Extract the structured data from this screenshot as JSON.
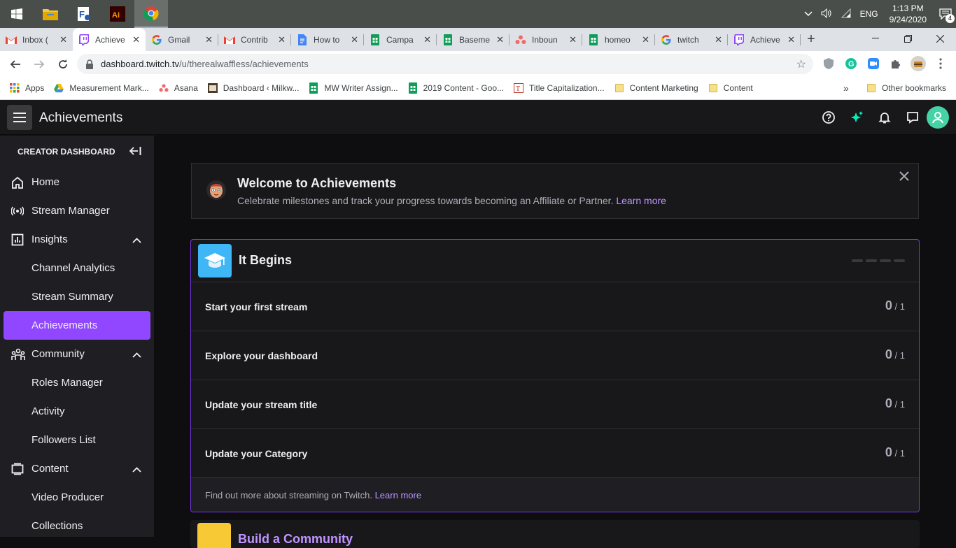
{
  "taskbar": {
    "apps": [
      "start",
      "file-explorer",
      "foxit-reader",
      "adobe-illustrator",
      "chrome"
    ],
    "time": "1:13 PM",
    "date": "9/24/2020",
    "language": "ENG",
    "notification_count": "4"
  },
  "browser": {
    "tabs": [
      {
        "label": "Inbox (",
        "icon": "gmail"
      },
      {
        "label": "Achieve",
        "icon": "twitch",
        "active": true
      },
      {
        "label": "Gmail",
        "icon": "google"
      },
      {
        "label": "Contrib",
        "icon": "gmail"
      },
      {
        "label": "How to",
        "icon": "docs"
      },
      {
        "label": "Campa",
        "icon": "sheets"
      },
      {
        "label": "Baseme",
        "icon": "sheets"
      },
      {
        "label": "Inboun",
        "icon": "asana"
      },
      {
        "label": "homeo",
        "icon": "sheets"
      },
      {
        "label": "twitch",
        "icon": "google"
      },
      {
        "label": "Achieve",
        "icon": "twitch"
      }
    ],
    "url_host": "dashboard.twitch.tv",
    "url_path": "/u/therealwaffless/achievements",
    "bookmarks": [
      {
        "label": "Apps",
        "icon": "apps-grid"
      },
      {
        "label": "Measurement Mark...",
        "icon": "drive"
      },
      {
        "label": "Asana",
        "icon": "asana"
      },
      {
        "label": "Dashboard ‹ Milkw...",
        "icon": "site"
      },
      {
        "label": "MW Writer Assign...",
        "icon": "sheets"
      },
      {
        "label": "2019 Content - Goo...",
        "icon": "sheets"
      },
      {
        "label": "Title Capitalization...",
        "icon": "tc"
      },
      {
        "label": "Content Marketing",
        "icon": "folder"
      },
      {
        "label": "Content",
        "icon": "folder"
      }
    ],
    "other_bookmarks": "Other bookmarks",
    "more": "»"
  },
  "twitch": {
    "page_title": "Achievements",
    "sidebar": {
      "heading": "CREATOR DASHBOARD",
      "items": [
        {
          "label": "Home",
          "icon": "home-icon",
          "type": "top"
        },
        {
          "label": "Stream Manager",
          "icon": "broadcast-icon",
          "type": "top"
        },
        {
          "label": "Insights",
          "icon": "insights-icon",
          "type": "top",
          "expanded": true
        },
        {
          "label": "Channel Analytics",
          "type": "sub"
        },
        {
          "label": "Stream Summary",
          "type": "sub"
        },
        {
          "label": "Achievements",
          "type": "sub",
          "active": true
        },
        {
          "label": "Community",
          "icon": "community-icon",
          "type": "top",
          "expanded": true
        },
        {
          "label": "Roles Manager",
          "type": "sub"
        },
        {
          "label": "Activity",
          "type": "sub"
        },
        {
          "label": "Followers List",
          "type": "sub"
        },
        {
          "label": "Content",
          "icon": "content-icon",
          "type": "top",
          "expanded": true
        },
        {
          "label": "Video Producer",
          "type": "sub"
        },
        {
          "label": "Collections",
          "type": "sub"
        }
      ]
    },
    "welcome": {
      "title": "Welcome to Achievements",
      "desc": "Celebrate milestones and track your progress towards becoming an Affiliate or Partner.",
      "link": "Learn more"
    },
    "card": {
      "title": "It Begins",
      "rows": [
        {
          "label": "Start your first stream",
          "value": "0",
          "total": "/ 1"
        },
        {
          "label": "Explore your dashboard",
          "value": "0",
          "total": "/ 1"
        },
        {
          "label": "Update your stream title",
          "value": "0",
          "total": "/ 1"
        },
        {
          "label": "Update your Category",
          "value": "0",
          "total": "/ 1"
        }
      ],
      "footer": "Find out more about streaming on Twitch.",
      "footer_link": "Learn more"
    },
    "card2": {
      "title": "Build a Community"
    }
  },
  "colors": {
    "accent": "#9147ff",
    "link": "#bf94ff",
    "badge_blue": "#3fb6f5",
    "badge_yellow": "#f7c935"
  }
}
